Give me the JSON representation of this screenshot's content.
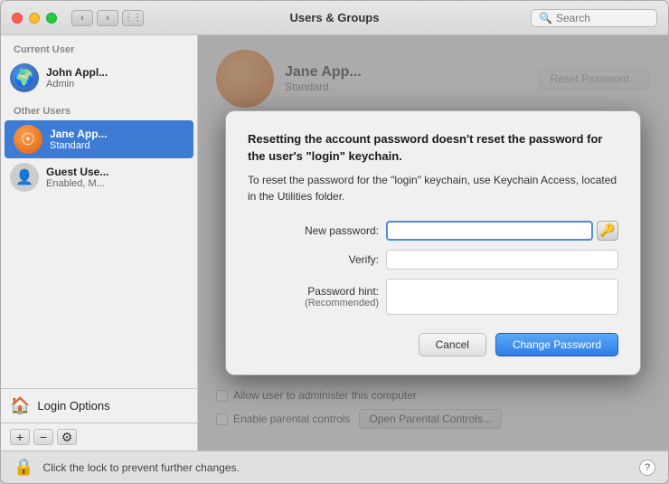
{
  "window": {
    "title": "Users & Groups"
  },
  "search": {
    "placeholder": "Search"
  },
  "sidebar": {
    "current_user_label": "Current User",
    "other_users_label": "Other Users",
    "users": [
      {
        "id": "john",
        "name": "John Appl...",
        "role": "Admin",
        "avatar_type": "admin"
      },
      {
        "id": "jane",
        "name": "Jane App...",
        "role": "Standard",
        "avatar_type": "jane",
        "selected": true
      },
      {
        "id": "guest",
        "name": "Guest Use...",
        "role": "Enabled, M...",
        "avatar_type": "guest"
      }
    ],
    "login_options_label": "Login Options",
    "toolbar": {
      "add_label": "+",
      "remove_label": "−",
      "gear_label": "⚙"
    }
  },
  "main": {
    "reset_password_btn": "Reset Password...",
    "allow_admin_label": "Allow user to administer this computer",
    "parental_controls_label": "Enable parental controls",
    "open_parental_btn": "Open Parental Controls..."
  },
  "modal": {
    "title": "Resetting the account password doesn't reset the password for the user's \"login\" keychain.",
    "desc": "To reset the password for the \"login\" keychain, use Keychain Access, located in the Utilities folder.",
    "new_password_label": "New password:",
    "verify_label": "Verify:",
    "hint_label": "Password hint:",
    "hint_sublabel": "(Recommended)",
    "cancel_btn": "Cancel",
    "change_password_btn": "Change Password"
  },
  "bottom_bar": {
    "lock_text": "Click the lock to prevent further changes."
  }
}
